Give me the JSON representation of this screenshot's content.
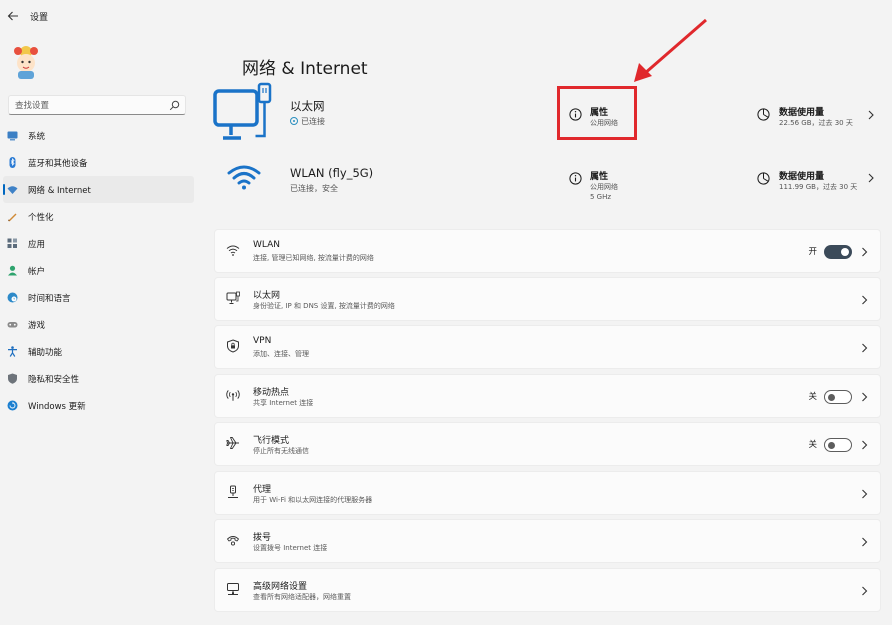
{
  "window": {
    "title": "设置"
  },
  "search": {
    "placeholder": "查找设置"
  },
  "sidebar": {
    "items": [
      {
        "label": "系统",
        "icon": "monitor-icon",
        "color": "#3b7fc4"
      },
      {
        "label": "蓝牙和其他设备",
        "icon": "bluetooth-icon",
        "color": "#2b7bd4"
      },
      {
        "label": "网络 & Internet",
        "icon": "wifi-icon",
        "color": "#3f82c7",
        "active": true
      },
      {
        "label": "个性化",
        "icon": "pen-icon",
        "color": "#d08a36"
      },
      {
        "label": "应用",
        "icon": "apps-icon",
        "color": "#5b6b7b"
      },
      {
        "label": "帐户",
        "icon": "account-icon",
        "color": "#2ea36d"
      },
      {
        "label": "时间和语言",
        "icon": "globe-clock-icon",
        "color": "#2d8ac9"
      },
      {
        "label": "游戏",
        "icon": "gamepad-icon",
        "color": "#8a8a8a"
      },
      {
        "label": "辅助功能",
        "icon": "accessibility-icon",
        "color": "#1f6fc0"
      },
      {
        "label": "隐私和安全性",
        "icon": "shield-icon",
        "color": "#6d737a"
      },
      {
        "label": "Windows 更新",
        "icon": "update-icon",
        "color": "#1b7fd0"
      }
    ]
  },
  "page": {
    "title": "网络 & Internet"
  },
  "ethernet_card": {
    "name": "以太网",
    "status": "已连接",
    "properties_label": "属性",
    "properties_sub": "公用网络",
    "usage_label": "数据使用量",
    "usage_sub": "22.56 GB，过去 30 天"
  },
  "wlan_card": {
    "name": "WLAN (fly_5G)",
    "status": "已连接，安全",
    "properties_label": "属性",
    "properties_sub": "公用网络",
    "properties_sub2": "5 GHz",
    "usage_label": "数据使用量",
    "usage_sub": "111.99 GB，过去 30 天"
  },
  "settings_rows": [
    {
      "title": "WLAN",
      "desc": "连接, 管理已知网络, 按流量计费的网络",
      "icon": "wifi-icon",
      "toggle": {
        "label": "开",
        "state": "on"
      }
    },
    {
      "title": "以太网",
      "desc": "身份验证, IP 和 DNS 设置, 按流量计费的网络",
      "icon": "ethernet-icon"
    },
    {
      "title": "VPN",
      "desc": "添加、连接、管理",
      "icon": "vpn-shield-icon"
    },
    {
      "title": "移动热点",
      "desc": "共享 Internet 连接",
      "icon": "hotspot-icon",
      "toggle": {
        "label": "关",
        "state": "off"
      }
    },
    {
      "title": "飞行模式",
      "desc": "停止所有无线通信",
      "icon": "airplane-icon",
      "toggle": {
        "label": "关",
        "state": "off"
      }
    },
    {
      "title": "代理",
      "desc": "用于 Wi-Fi 和以太网连接的代理服务器",
      "icon": "proxy-icon"
    },
    {
      "title": "拨号",
      "desc": "设置拨号 Internet 连接",
      "icon": "dialup-icon"
    },
    {
      "title": "高级网络设置",
      "desc": "查看所有网络适配器，网络重置",
      "icon": "advanced-network-icon"
    }
  ],
  "colors": {
    "accent": "#0067c0",
    "highlight": "#e0282c",
    "card": "#fbfbfb",
    "background": "#f3f3f3"
  }
}
